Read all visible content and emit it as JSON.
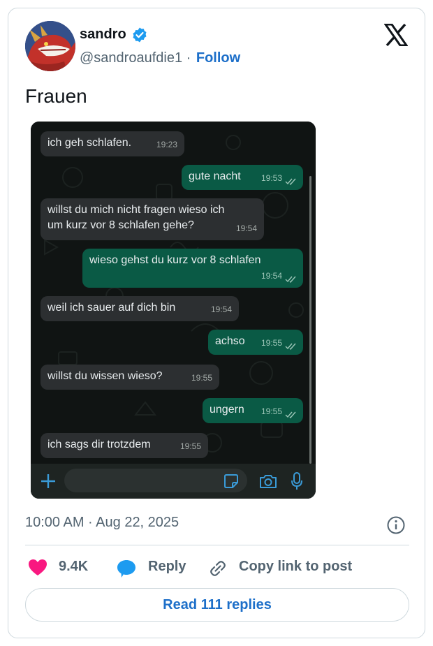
{
  "author": {
    "name": "sandro",
    "handle": "@sandroaufdie1",
    "separator": "·",
    "follow_label": "Follow",
    "verified": true
  },
  "tweet": {
    "text": "Frauen"
  },
  "chat": {
    "messages": [
      {
        "direction": "in",
        "text": "ich geh schlafen.",
        "time": "19:23"
      },
      {
        "direction": "out",
        "text": "gute nacht",
        "time": "19:53"
      },
      {
        "direction": "in",
        "text": "willst du mich nicht fragen wieso ich\num kurz vor 8 schlafen gehe?",
        "time": "19:54"
      },
      {
        "direction": "out",
        "text": "wieso gehst du kurz vor 8 schlafen",
        "time": "19:54"
      },
      {
        "direction": "in",
        "text": "weil ich sauer auf dich bin",
        "time": "19:54"
      },
      {
        "direction": "out",
        "text": "achso",
        "time": "19:55"
      },
      {
        "direction": "in",
        "text": "willst du wissen wieso?",
        "time": "19:55"
      },
      {
        "direction": "out",
        "text": "ungern",
        "time": "19:55"
      },
      {
        "direction": "in",
        "text": "ich sags dir trotzdem",
        "time": "19:55"
      }
    ],
    "composer_icons": [
      "plus-icon",
      "sticker-icon",
      "camera-icon",
      "microphone-icon"
    ]
  },
  "meta": {
    "timestamp": "10:00 AM · Aug 22, 2025"
  },
  "actions": {
    "likes_count": "9.4K",
    "reply_label": "Reply",
    "copy_label": "Copy link to post"
  },
  "read_replies_label": "Read 111 replies",
  "colors": {
    "link_blue": "#1d6fc9",
    "verified_blue": "#1d9bf0",
    "like_pink": "#f91880",
    "reply_blue": "#1d9bf0",
    "outgoing_bubble": "#0a5a45",
    "incoming_bubble": "#2c2f31"
  }
}
